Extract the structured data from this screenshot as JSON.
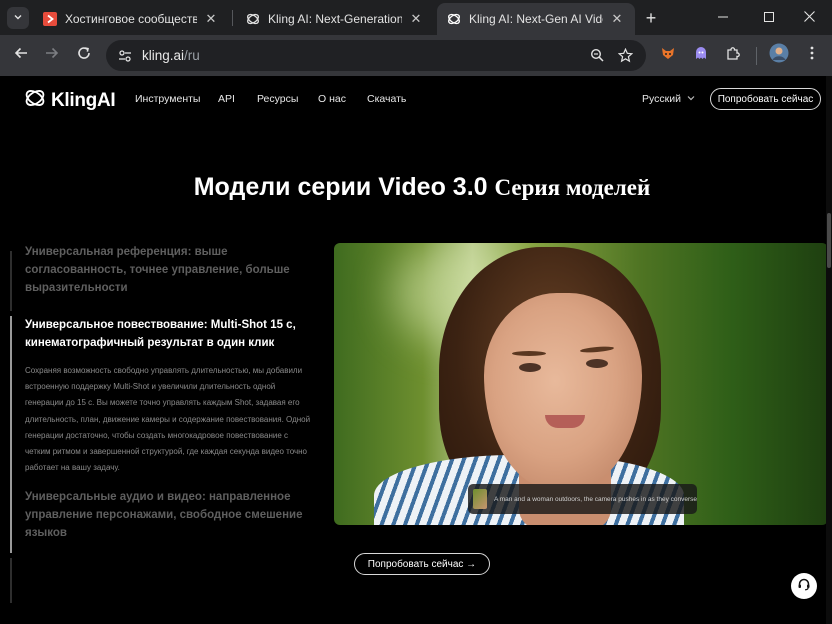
{
  "browser": {
    "tabs": [
      {
        "title": "Хостинговое сообщество «Т",
        "favicon": "timeweb-icon",
        "favicon_color": "#e74c3c",
        "active": false
      },
      {
        "title": "Kling AI: Next-Generation AI C",
        "favicon": "kling-icon",
        "active": false
      },
      {
        "title": "Kling AI: Next-Gen AI Video &",
        "favicon": "kling-icon",
        "active": true
      }
    ],
    "url": {
      "host": "kling.ai",
      "path": "/ru"
    }
  },
  "site": {
    "logo_text": "KlingAI",
    "nav": [
      "Инструменты",
      "API",
      "Ресурсы",
      "О нас",
      "Скачать"
    ],
    "language": "Русский",
    "try_now_top": "Попробовать сейчас",
    "headline": {
      "main": "Модели серии Video 3.0",
      "serif": "Серия моделей"
    },
    "features": [
      {
        "title": "Универсальная референция: выше согласованность, точнее управление, больше выразительности",
        "state": "inactive"
      },
      {
        "title": "Универсальное повествование: Multi-Shot 15 с, кинематографичный результат в один клик",
        "state": "active",
        "description": "Сохраняя возможность свободно управлять длительностью, мы добавили встроенную поддержку Multi-Shot и увеличили длительность одной генерации до 15 с. Вы можете точно управлять каждым Shot, задавая его длительность, план, движение камеры и содержание повествования. Одной генерации достаточно, чтобы создать многокадровое повествование с четким ритмом и завершенной структурой, где каждая секунда видео точно работает на вашу задачу."
      },
      {
        "title": "Универсальные аудио и видео: направленное управление персонажами, свободное смешение языков",
        "state": "inactive"
      }
    ],
    "video_caption": "A man and a woman outdoors, the camera pushes in as they converse",
    "try_now_bottom": "Попробовать сейчас →"
  }
}
